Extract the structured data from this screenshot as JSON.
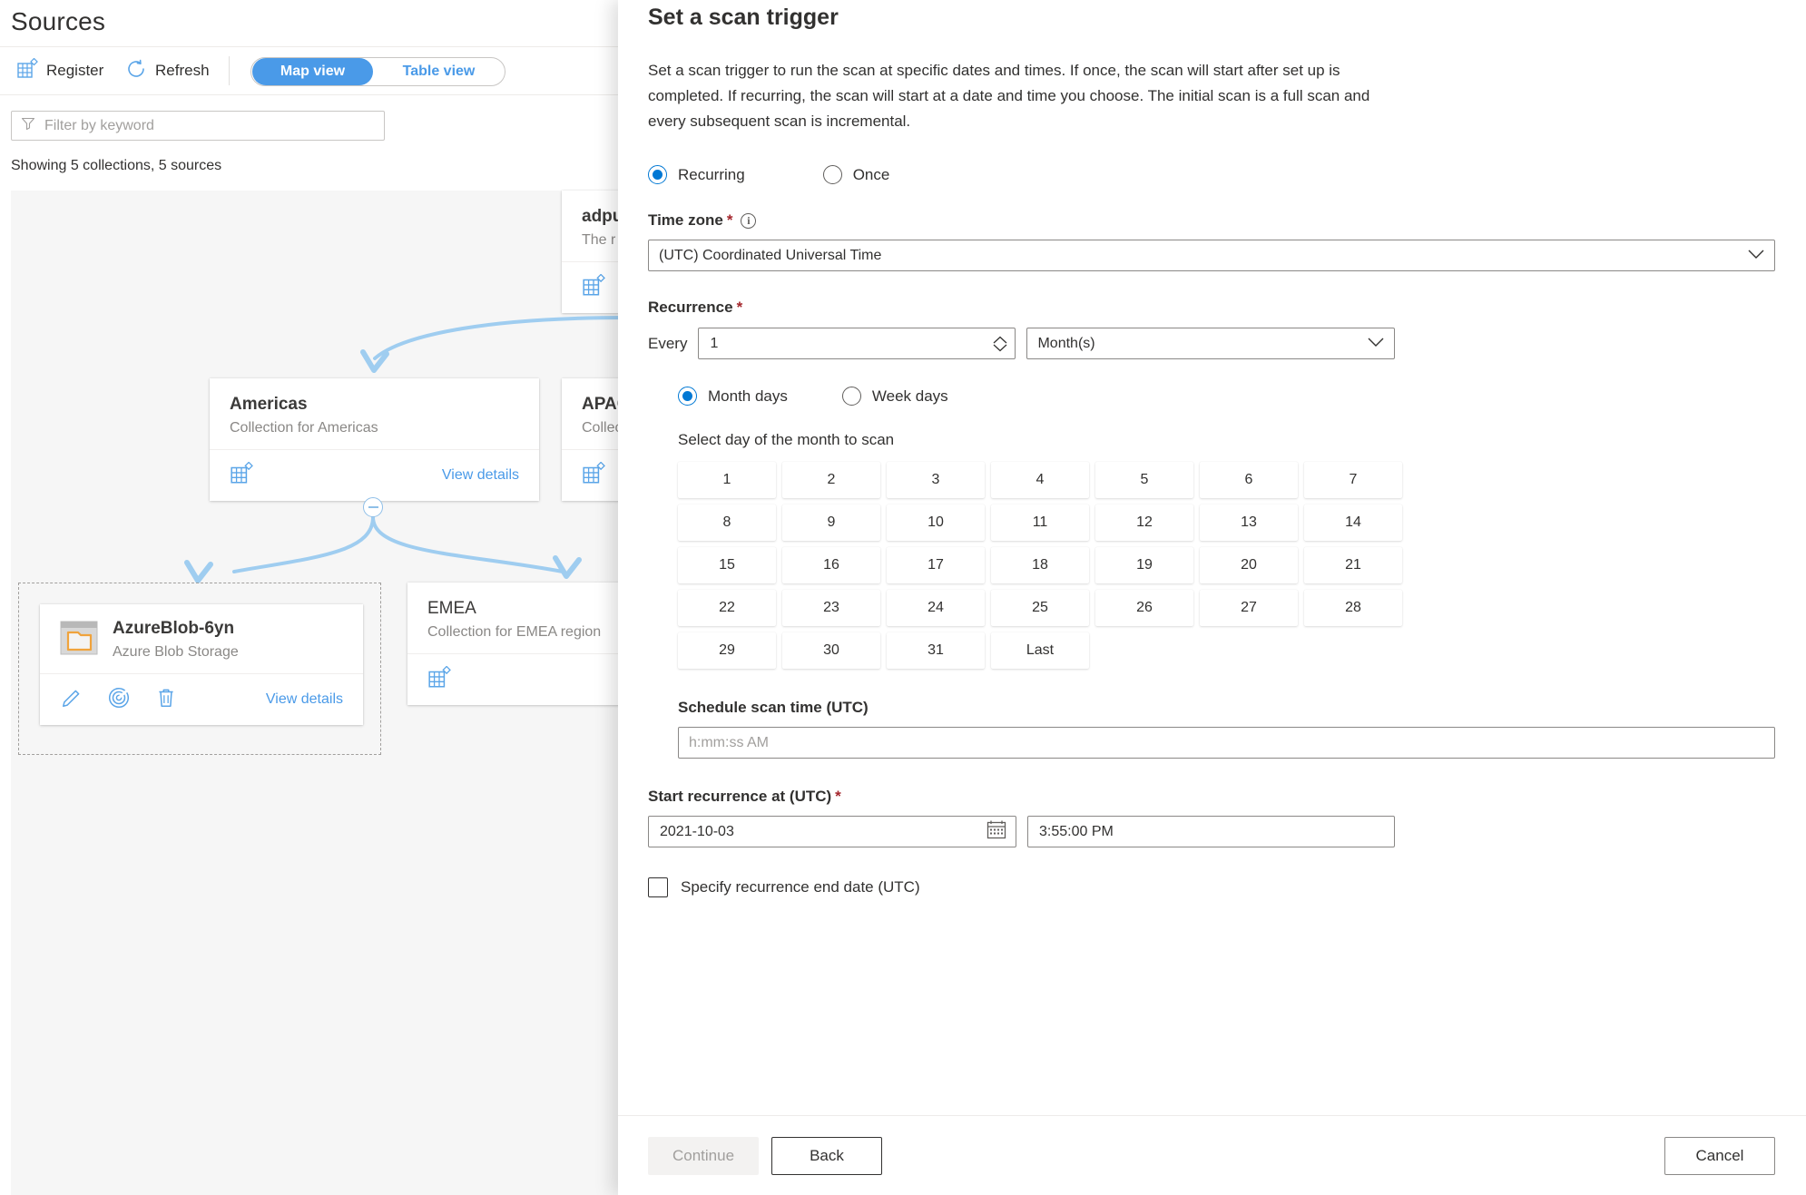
{
  "background": {
    "page_title": "Sources",
    "commands": [
      {
        "label": "Register",
        "icon": "register-grid-icon"
      },
      {
        "label": "Refresh",
        "icon": "refresh-icon"
      }
    ],
    "view_pivot": {
      "selected": "Map view",
      "unselected": "Table view"
    },
    "filter": {
      "placeholder": "Filter by keyword",
      "icon": "filter-icon"
    },
    "showing": "Showing 5 collections, 5 sources",
    "cards": [
      {
        "name": "adpurviewacct",
        "desc": "The r",
        "link": "",
        "icon": "collection-icon"
      },
      {
        "name": "Americas",
        "desc": "Collection for Americas",
        "link": "View details",
        "icon": "collection-icon"
      },
      {
        "name": "APAC",
        "desc": "Collec",
        "link": "",
        "icon": "collection-icon"
      },
      {
        "name": "AzureBlob-6yn",
        "desc": "Azure Blob Storage",
        "link": "View details",
        "icon": "azure-blob-icon"
      },
      {
        "name": "EMEA",
        "desc": "Collection for EMEA region",
        "link": "",
        "icon": "collection-icon"
      }
    ],
    "source_actions": [
      {
        "icon": "edit-pencil-icon"
      },
      {
        "icon": "scan-radar-icon"
      },
      {
        "icon": "delete-trash-icon"
      }
    ]
  },
  "panel": {
    "title": "Set a scan trigger",
    "description": "Set a scan trigger to run the scan at specific dates and times. If once, the scan will start after set up is completed. If recurring, the scan will start at a date and time you choose. The initial scan is a full scan and every subsequent scan is incremental.",
    "trigger_mode": {
      "options": [
        {
          "label": "Recurring",
          "selected": true
        },
        {
          "label": "Once",
          "selected": false
        }
      ]
    },
    "time_zone": {
      "label": "Time zone",
      "required": "*",
      "info_icon": "info-icon",
      "value": "(UTC) Coordinated Universal Time"
    },
    "recurrence": {
      "label": "Recurrence",
      "required": "*",
      "every_label": "Every",
      "every_value": "1",
      "unit_value": "Month(s)"
    },
    "day_mode": {
      "options": [
        {
          "label": "Month days",
          "selected": true
        },
        {
          "label": "Week days",
          "selected": false
        }
      ]
    },
    "day_select": {
      "header": "Select day of the month to scan",
      "days": [
        "1",
        "2",
        "3",
        "4",
        "5",
        "6",
        "7",
        "8",
        "9",
        "10",
        "11",
        "12",
        "13",
        "14",
        "15",
        "16",
        "17",
        "18",
        "19",
        "20",
        "21",
        "22",
        "23",
        "24",
        "25",
        "26",
        "27",
        "28",
        "29",
        "30",
        "31",
        "Last"
      ]
    },
    "schedule_scan_time": {
      "label": "Schedule scan time (UTC)",
      "placeholder": "h:mm:ss AM",
      "value": ""
    },
    "start_recurrence": {
      "label": "Start recurrence at (UTC)",
      "required": "*",
      "date_value": "2021-10-03",
      "date_icon": "calendar-icon",
      "time_value": "3:55:00 PM"
    },
    "end_date_checkbox": {
      "label": "Specify recurrence end date (UTC)",
      "checked": false
    },
    "footer": {
      "continue_label": "Continue",
      "back_label": "Back",
      "cancel_label": "Cancel"
    }
  },
  "colors": {
    "accent": "#0078d4",
    "link": "#4a9ae8",
    "required": "#a4262c",
    "canvas": "#f6f6f6"
  }
}
